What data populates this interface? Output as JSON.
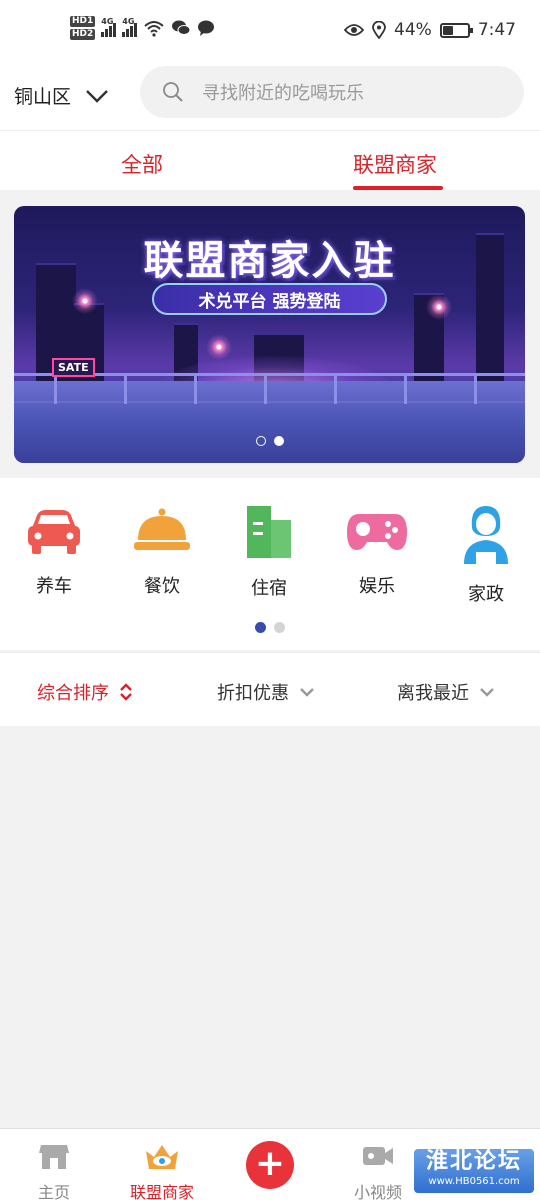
{
  "status_bar": {
    "hd1": "HD1",
    "hd2": "HD2",
    "net1": "4G",
    "net2": "4G",
    "battery_percent": "44%",
    "battery_level": 0.44,
    "time": "7:47"
  },
  "header": {
    "city": "铜山区",
    "search_placeholder": "寻找附近的吃喝玩乐"
  },
  "tabs": [
    {
      "label": "全部"
    },
    {
      "label": "联盟商家",
      "active": true
    }
  ],
  "banner": {
    "title": "联盟商家入驻",
    "subtitle": "术兑平台 强势登陆",
    "sign": "SATE",
    "slide_count": 2,
    "active_slide": 2
  },
  "categories": [
    {
      "label": "养车",
      "icon": "car-icon",
      "color": "#ee5a52"
    },
    {
      "label": "餐饮",
      "icon": "food-cloche-icon",
      "color": "#f2a23a"
    },
    {
      "label": "住宿",
      "icon": "building-icon",
      "color": "#52b75b"
    },
    {
      "label": "娱乐",
      "icon": "gamepad-icon",
      "color": "#ee6ba0"
    },
    {
      "label": "家政",
      "icon": "housekeeper-icon",
      "color": "#2fa2e6"
    }
  ],
  "filters": [
    {
      "label": "综合排序",
      "active": true,
      "icon": "sort-icon"
    },
    {
      "label": "折扣优惠",
      "icon": "chevron-down-icon"
    },
    {
      "label": "离我最近",
      "icon": "chevron-down-icon"
    }
  ],
  "bottom_nav": [
    {
      "label": "主页",
      "icon": "store-icon"
    },
    {
      "label": "联盟商家",
      "icon": "crown-eye-icon",
      "active": true
    },
    {
      "label": "",
      "icon": "plus-icon"
    },
    {
      "label": "小视频",
      "icon": "video-camera-icon"
    }
  ],
  "watermark": {
    "name": "淮北论坛",
    "url": "www.HB0561.com"
  },
  "colors": {
    "accent": "#d8232a",
    "page_bg": "#f2f2f2",
    "dot_active": "#3a4bb0"
  }
}
